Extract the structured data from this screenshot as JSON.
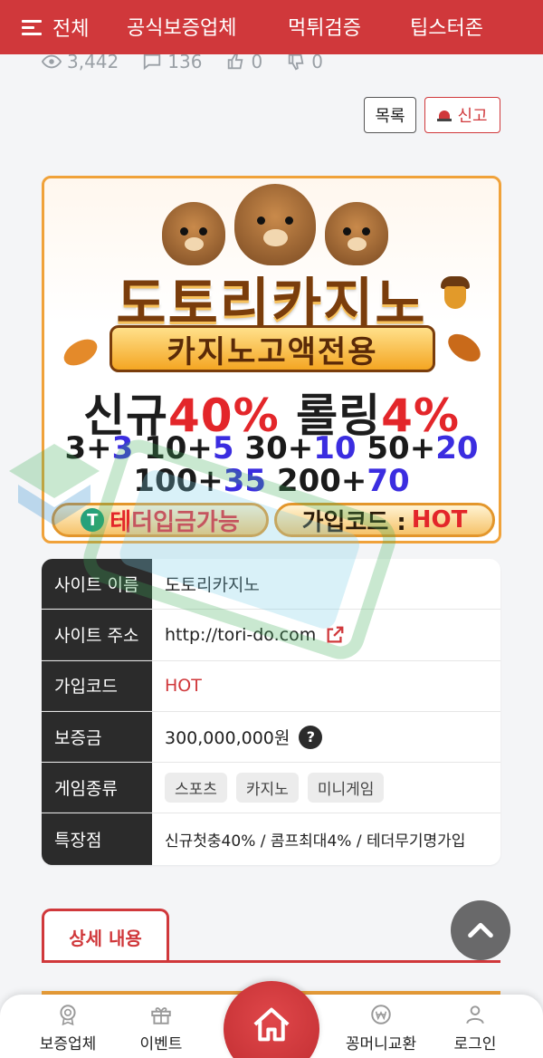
{
  "topnav": {
    "all": "전체",
    "items": [
      "공식보증업체",
      "먹튀검증",
      "팁스터존"
    ]
  },
  "stats": {
    "views": "3,442",
    "comments": "136",
    "likes": "0",
    "dislikes": "0"
  },
  "actions": {
    "list": "목록",
    "report": "신고"
  },
  "banner": {
    "title": "도토리카지노",
    "ribbon": "카지노고액전용",
    "promo1_a": "신규",
    "promo1_b": "40%",
    "promo1_c": " 롤링",
    "promo1_d": "4%",
    "promo2_line1": [
      {
        "t": "3+",
        "c": ""
      },
      {
        "t": "3",
        "c": "blue"
      },
      {
        "t": " 10+",
        "c": ""
      },
      {
        "t": "5",
        "c": "blue"
      },
      {
        "t": " 30+",
        "c": ""
      },
      {
        "t": "10",
        "c": "blue"
      },
      {
        "t": " 50+",
        "c": ""
      },
      {
        "t": "20",
        "c": "blue"
      }
    ],
    "promo2_line2": [
      {
        "t": "100+",
        "c": ""
      },
      {
        "t": "35",
        "c": "blue"
      },
      {
        "t": " 200+",
        "c": ""
      },
      {
        "t": "70",
        "c": "blue"
      }
    ],
    "pill1": "테더입금가능",
    "pill2_label": "가입코드 :",
    "pill2_code": "HOT",
    "tether_symbol": "T"
  },
  "info": {
    "rows": [
      {
        "label": "사이트 이름",
        "value": "도토리카지노"
      },
      {
        "label": "사이트 주소",
        "value": "http://tori-do.com"
      },
      {
        "label": "가입코드",
        "value": "HOT"
      },
      {
        "label": "보증금",
        "value": "300,000,000원"
      },
      {
        "label": "게임종류",
        "tags": [
          "스포츠",
          "카지노",
          "미니게임"
        ]
      },
      {
        "label": "특장점",
        "value": "신규첫충40% / 콤프최대4% / 테더무기명가입"
      }
    ],
    "help_symbol": "?"
  },
  "detail": {
    "tab": "상세 내용"
  },
  "bottomnav": {
    "items": [
      "보증업체",
      "이벤트",
      "꽁머니교환",
      "로그인"
    ]
  },
  "colors": {
    "brand": "#d0383b",
    "banner_border": "#f0a23a",
    "promo_blue": "#3b2de0"
  }
}
